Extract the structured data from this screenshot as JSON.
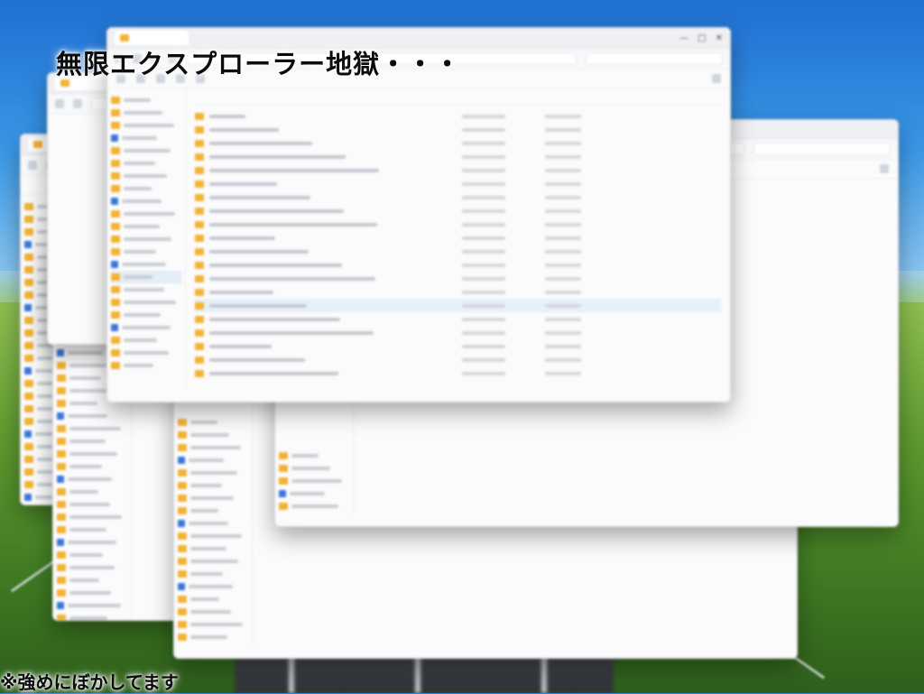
{
  "overlay": {
    "headline": "無限エクスプローラー地獄・・・",
    "footnote": "※強めにぼかしてます"
  },
  "colors": {
    "folder": "#f2b233",
    "accent": "#3b78d8",
    "selection": "#e6f0fb",
    "window_bg": "#fbfbfc"
  },
  "icons": [
    "folder-icon",
    "back-icon",
    "forward-icon",
    "up-icon",
    "refresh-icon",
    "search-icon",
    "minimize-icon",
    "maximize-icon",
    "close-icon",
    "pc-icon",
    "drive-icon",
    "cloud-icon"
  ]
}
